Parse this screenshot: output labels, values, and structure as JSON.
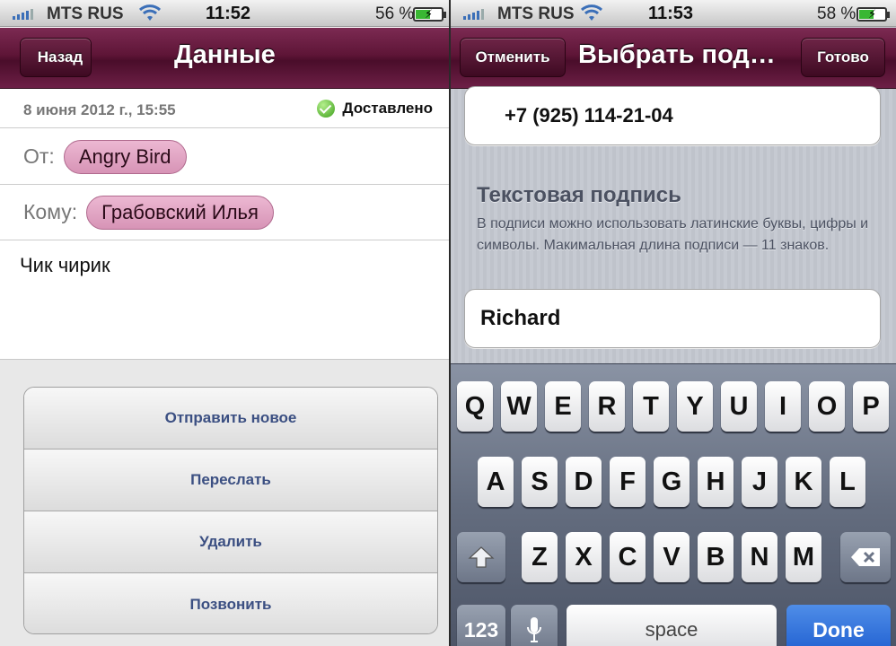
{
  "left": {
    "status": {
      "carrier": "MTS RUS",
      "time": "11:52",
      "battery": "56 %",
      "battery_level": 0.56
    },
    "nav": {
      "back_label": "Назад",
      "title": "Данные"
    },
    "date": "8 июня 2012 г., 15:55",
    "delivered": "Доставлено",
    "from": {
      "label": "От:",
      "value": "Angry Bird"
    },
    "to": {
      "label": "Кому:",
      "value": "Грабовский Илья"
    },
    "message": "Чик чирик",
    "actions": [
      "Отправить новое",
      "Переслать",
      "Удалить",
      "Позвонить"
    ]
  },
  "right": {
    "status": {
      "carrier": "MTS RUS",
      "time": "11:53",
      "battery": "58 %",
      "battery_level": 0.58
    },
    "nav": {
      "cancel_label": "Отменить",
      "title": "Выбрать под…",
      "done_label": "Готово"
    },
    "phone": "+7 (925) 114-21-04",
    "section_title": "Текстовая подпись",
    "section_desc": "В подписи можно использовать латинские буквы, цифры и символы. Макимальная длина подписи — 11 знаков.",
    "name_value": "Richard",
    "keyboard": {
      "row1": [
        "Q",
        "W",
        "E",
        "R",
        "T",
        "Y",
        "U",
        "I",
        "O",
        "P"
      ],
      "row2": [
        "A",
        "S",
        "D",
        "F",
        "G",
        "H",
        "J",
        "K",
        "L"
      ],
      "row3": [
        "Z",
        "X",
        "C",
        "V",
        "B",
        "N",
        "M"
      ],
      "numbers_label": "123",
      "space_label": "space",
      "done_label": "Done"
    }
  },
  "colors": {
    "nav_accent": "#5e1537",
    "pill": "#d794b6",
    "action_text": "#3b4f82",
    "done_key": "#1f5fd0"
  }
}
